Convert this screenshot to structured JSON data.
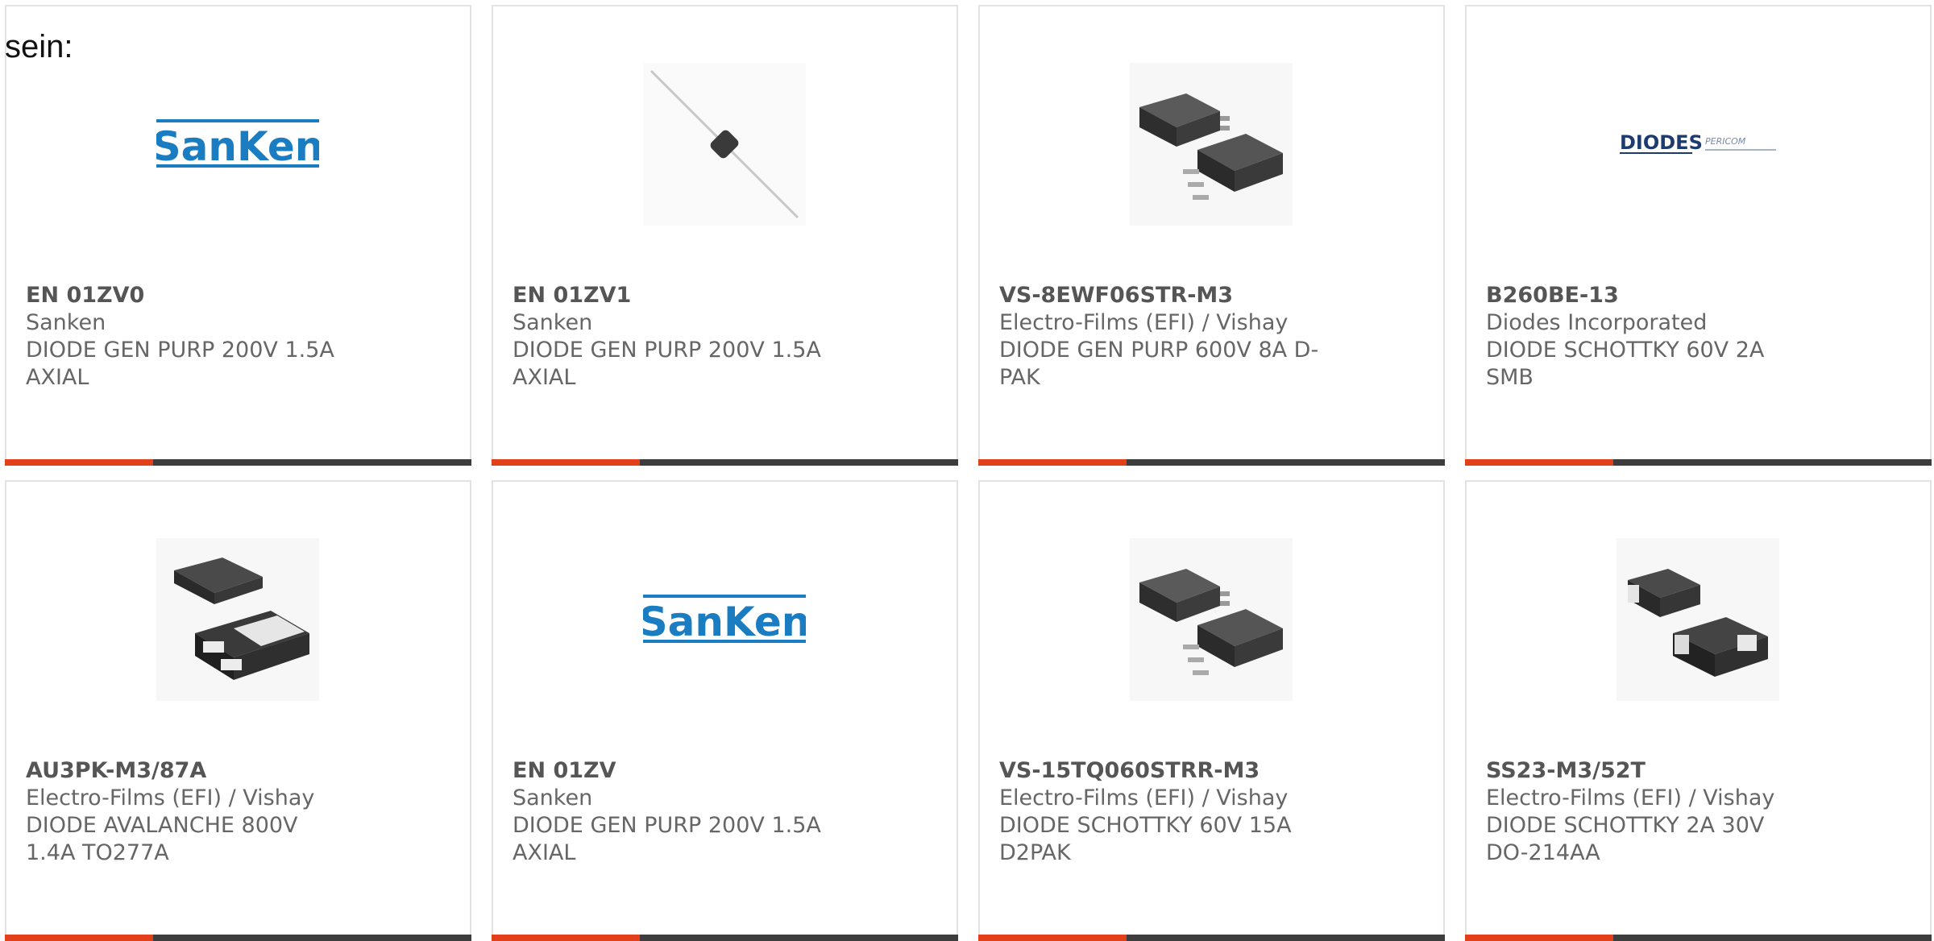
{
  "intro_text": "sein:",
  "products": [
    {
      "part_number": "EN 01ZV0",
      "manufacturer": "Sanken",
      "description": "DIODE GEN PURP 200V 1.5A AXIAL",
      "image": "sanken-logo"
    },
    {
      "part_number": "EN 01ZV1",
      "manufacturer": "Sanken",
      "description": "DIODE GEN PURP 200V 1.5A AXIAL",
      "image": "axial-diode"
    },
    {
      "part_number": "VS-8EWF06STR-M3",
      "manufacturer": "Electro-Films (EFI) / Vishay",
      "description": "DIODE GEN PURP 600V 8A D-PAK",
      "image": "dpak-package"
    },
    {
      "part_number": "B260BE-13",
      "manufacturer": "Diodes Incorporated",
      "description": "DIODE SCHOTTKY 60V 2A SMB",
      "image": "diodes-pericom-logo"
    },
    {
      "part_number": "AU3PK-M3/87A",
      "manufacturer": "Electro-Films (EFI) / Vishay",
      "description": "DIODE AVALANCHE 800V 1.4A TO277A",
      "image": "to277a-package"
    },
    {
      "part_number": "EN 01ZV",
      "manufacturer": "Sanken",
      "description": "DIODE GEN PURP 200V 1.5A AXIAL",
      "image": "sanken-logo"
    },
    {
      "part_number": "VS-15TQ060STRR-M3",
      "manufacturer": "Electro-Films (EFI) / Vishay",
      "description": "DIODE SCHOTTKY 60V 15A D2PAK",
      "image": "d2pak-package"
    },
    {
      "part_number": "SS23-M3/52T",
      "manufacturer": "Electro-Films (EFI) / Vishay",
      "description": "DIODE SCHOTTKY 2A 30V DO-214AA",
      "image": "smb-package"
    }
  ],
  "logos": {
    "sanken": "SanKen",
    "diodes": "DIODES",
    "pericom": "PERICOM"
  },
  "colors": {
    "accent": "#e2401a",
    "bar": "#3d3d3d",
    "sanken_blue": "#1a7cc1",
    "diodes_navy": "#1d3b6e",
    "text": "#666666"
  }
}
